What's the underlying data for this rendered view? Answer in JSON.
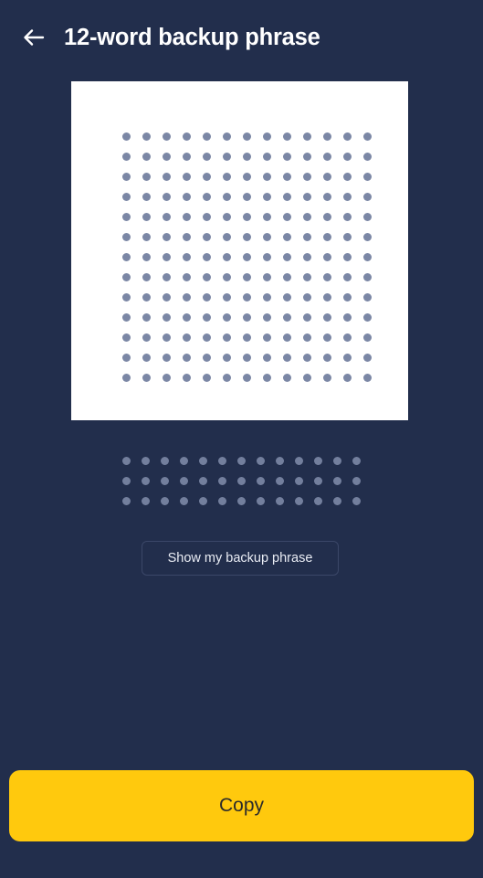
{
  "theme": {
    "background": "#222e4c",
    "card_background": "#ffffff",
    "dot_color": "#7b87a5",
    "accent": "#ffc90d",
    "accent_text": "#2b2b2b",
    "title_color": "#ffffff",
    "outline_border": "#3b4768"
  },
  "header": {
    "back_icon": "arrow-left-icon",
    "title": "12-word backup phrase"
  },
  "qr_card": {
    "icon": "qr-code-icon",
    "columns": 13,
    "rows": 13,
    "dot_color": "#7b87a5"
  },
  "phrase_mask": {
    "columns": 13,
    "rows": 3,
    "dot_color": "#737f9d"
  },
  "reveal_button": {
    "label": "Show my backup phrase"
  },
  "primary_button": {
    "label": "Copy"
  }
}
